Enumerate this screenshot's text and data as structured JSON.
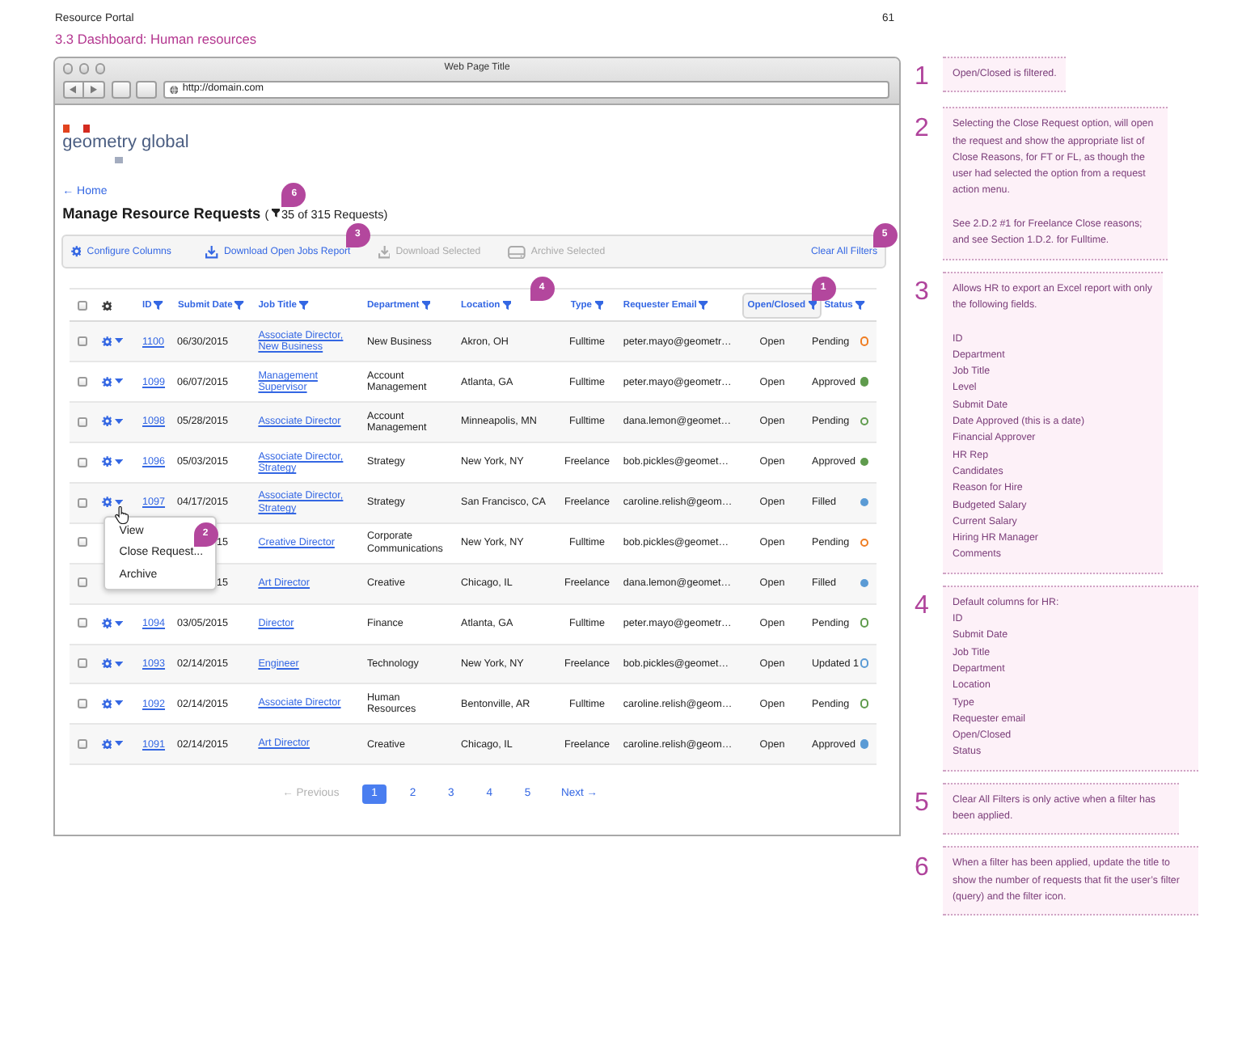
{
  "document": {
    "title": "Resource Portal",
    "page_number": "61",
    "section": "3.3 Dashboard: Human resources"
  },
  "browser": {
    "title": "Web Page Title",
    "url": "http://domain.com"
  },
  "logo": {
    "text": "geometry global"
  },
  "back_link": "← Home",
  "heading": {
    "title": "Manage Resource Requests",
    "count_prefix": "(",
    "filtered": true,
    "count": "35 of 315 Requests)",
    "callout": "6"
  },
  "toolbar": [
    {
      "kind": "configure",
      "label": "Configure Columns",
      "disabled": false
    },
    {
      "kind": "download",
      "label": "Download Open Jobs Report",
      "disabled": false,
      "callout": "3"
    },
    {
      "kind": "download",
      "label": "Download Selected",
      "disabled": true
    },
    {
      "kind": "archive",
      "label": "Archive Selected",
      "disabled": true
    },
    {
      "kind": "clear",
      "label": "Clear All Filters",
      "disabled": false,
      "callout": "5"
    }
  ],
  "table": {
    "select_all": {
      "checked": false
    },
    "columns": [
      {
        "label": "ID",
        "filtered": false
      },
      {
        "label": "Submit Date",
        "filtered": false
      },
      {
        "label": "Job Title",
        "filtered": false
      },
      {
        "label": "Department",
        "filtered": false
      },
      {
        "label": "Location",
        "filtered": false,
        "callout": "4"
      },
      {
        "label": "Type",
        "filtered": false
      },
      {
        "label": "Requester Email",
        "filtered": false
      },
      {
        "label": "Open/Closed",
        "filtered": true,
        "callout": "1"
      },
      {
        "label": "Status",
        "filtered": false
      }
    ],
    "rows": [
      {
        "checked": false,
        "id": "1100",
        "submit_date": "06/30/2015",
        "job_title": "Associate Director, New Business",
        "department": "New Business",
        "location": "Akron, OH",
        "type": "Fulltime",
        "requester_email": "peter.mayo@geometr…",
        "open_closed": "Open",
        "status": "Pending",
        "status_icon": {
          "kind": "ring",
          "color": "#ef7d22"
        },
        "menu_open": false
      },
      {
        "checked": false,
        "id": "1099",
        "submit_date": "06/07/2015",
        "job_title": "Management Supervisor",
        "department": "Account Management",
        "location": "Atlanta, GA",
        "type": "Fulltime",
        "requester_email": "peter.mayo@geometr…",
        "open_closed": "Open",
        "status": "Approved",
        "status_icon": {
          "kind": "dot",
          "color": "#5f9b4d"
        },
        "menu_open": false
      },
      {
        "checked": false,
        "id": "1098",
        "submit_date": "05/28/2015",
        "job_title": "Associate Director",
        "department": "Account Management",
        "location": "Minneapolis, MN",
        "type": "Fulltime",
        "requester_email": "dana.lemon@geomet…",
        "open_closed": "Open",
        "status": "Pending",
        "status_icon": {
          "kind": "ring",
          "color": "#5f9b4d"
        },
        "menu_open": false
      },
      {
        "checked": false,
        "id": "1096",
        "submit_date": "05/03/2015",
        "job_title": "Associate Director, Strategy",
        "department": "Strategy",
        "location": "New York, NY",
        "type": "Freelance",
        "requester_email": "bob.pickles@geomet…",
        "open_closed": "Open",
        "status": "Approved",
        "status_icon": {
          "kind": "dot",
          "color": "#5f9b4d"
        },
        "menu_open": false
      },
      {
        "checked": false,
        "id": "1097",
        "submit_date": "04/17/2015",
        "job_title": "Associate Director, Strategy",
        "department": "Strategy",
        "location": "San Francisco, CA",
        "type": "Freelance",
        "requester_email": "caroline.relish@geom…",
        "open_closed": "Open",
        "status": "Filled",
        "status_icon": {
          "kind": "dot",
          "color": "#5b9bd5"
        },
        "menu_open": true
      },
      {
        "checked": false,
        "submit_date": "15",
        "job_title": "Creative Director",
        "department": "Corporate Communications",
        "location": "New York, NY",
        "type": "Fulltime",
        "requester_email": "bob.pickles@geomet…",
        "open_closed": "Open",
        "status": "Pending",
        "status_icon": {
          "kind": "ring",
          "color": "#ef7d22"
        },
        "menu_open": false
      },
      {
        "checked": false,
        "submit_date": "15",
        "job_title": "Art Director",
        "department": "Creative",
        "location": "Chicago, IL",
        "type": "Freelance",
        "requester_email": "dana.lemon@geomet…",
        "open_closed": "Open",
        "status": "Filled",
        "status_icon": {
          "kind": "dot",
          "color": "#5b9bd5"
        },
        "menu_open": false
      },
      {
        "checked": false,
        "id": "1094",
        "submit_date": "03/05/2015",
        "job_title": "Director",
        "department": "Finance",
        "location": "Atlanta, GA",
        "type": "Fulltime",
        "requester_email": "peter.mayo@geometr…",
        "open_closed": "Open",
        "status": "Pending",
        "status_icon": {
          "kind": "ring",
          "color": "#5f9b4d"
        },
        "menu_open": false
      },
      {
        "checked": false,
        "id": "1093",
        "submit_date": "02/14/2015",
        "job_title": "Engineer",
        "department": "Technology",
        "location": "New York, NY",
        "type": "Freelance",
        "requester_email": "bob.pickles@geomet…",
        "open_closed": "Open",
        "status": "Updated 1",
        "status_icon": {
          "kind": "ring",
          "color": "#5b9bd5"
        },
        "menu_open": false
      },
      {
        "checked": false,
        "id": "1092",
        "submit_date": "02/14/2015",
        "job_title": "Associate Director",
        "department": "Human Resources",
        "location": "Bentonville, AR",
        "type": "Fulltime",
        "requester_email": "caroline.relish@geom…",
        "open_closed": "Open",
        "status": "Pending",
        "status_icon": {
          "kind": "ring",
          "color": "#5f9b4d"
        },
        "menu_open": false
      },
      {
        "checked": false,
        "id": "1091",
        "submit_date": "02/14/2015",
        "job_title": "Art Director",
        "department": "Creative",
        "location": "Chicago, IL",
        "type": "Freelance",
        "requester_email": "caroline.relish@geom…",
        "open_closed": "Open",
        "status": "Approved",
        "status_icon": {
          "kind": "dot",
          "color": "#5b9bd5"
        },
        "menu_open": false
      }
    ],
    "row_menu": {
      "items": [
        {
          "label": "View"
        },
        {
          "label": "Close Request...",
          "callout": "2"
        },
        {
          "label": "Archive"
        }
      ]
    }
  },
  "pagination": {
    "previous": {
      "label": "← Previous",
      "disabled": true
    },
    "pages": [
      {
        "label": "1",
        "selected": true
      },
      {
        "label": "2",
        "selected": false
      },
      {
        "label": "3",
        "selected": false
      },
      {
        "label": "4",
        "selected": false
      },
      {
        "label": "5",
        "selected": false
      }
    ],
    "next": {
      "label": "Next →",
      "disabled": false
    }
  },
  "notes": [
    {
      "number": "1",
      "blocks": [
        {
          "kind": "paragraph",
          "text": "Open/Closed is filtered."
        }
      ]
    },
    {
      "number": "2",
      "blocks": [
        {
          "kind": "paragraph",
          "text": "Selecting the Close Request option, will open the request and show the appropriate list of Close Reasons, for FT or FL, as though the user had selected the option from a request action menu."
        },
        {
          "kind": "paragraph",
          "text": "See 2.D.2 #1 for Freelance Close reasons; and see Section 1.D.2. for Fulltime."
        }
      ]
    },
    {
      "number": "3",
      "blocks": [
        {
          "kind": "paragraph",
          "text": "Allows HR to export an Excel report with only the following fields."
        },
        {
          "kind": "list",
          "items": [
            "ID",
            "Department",
            "Job Title",
            "Level",
            "Submit Date",
            "Date Approved (this is a date)",
            "Financial Approver",
            "HR Rep",
            "Candidates",
            "Reason for Hire",
            "Budgeted Salary",
            "Current Salary",
            "Hiring HR Manager",
            "Comments"
          ]
        }
      ]
    },
    {
      "number": "4",
      "blocks": [
        {
          "kind": "heading",
          "text": "Default columns for HR:"
        },
        {
          "kind": "list",
          "items": [
            "ID",
            "Submit Date",
            "Job Title",
            "Department",
            "Location",
            "Type",
            "Requester email",
            "Open/Closed",
            "Status"
          ]
        }
      ]
    },
    {
      "number": "5",
      "blocks": [
        {
          "kind": "paragraph",
          "text": "Clear All Filters is only active when a filter has been applied."
        }
      ]
    },
    {
      "number": "6",
      "blocks": [
        {
          "kind": "paragraph",
          "text": "When a filter has been applied, update the title to show the number of requests that fit the user’s filter (query) and the filter icon."
        }
      ]
    }
  ]
}
